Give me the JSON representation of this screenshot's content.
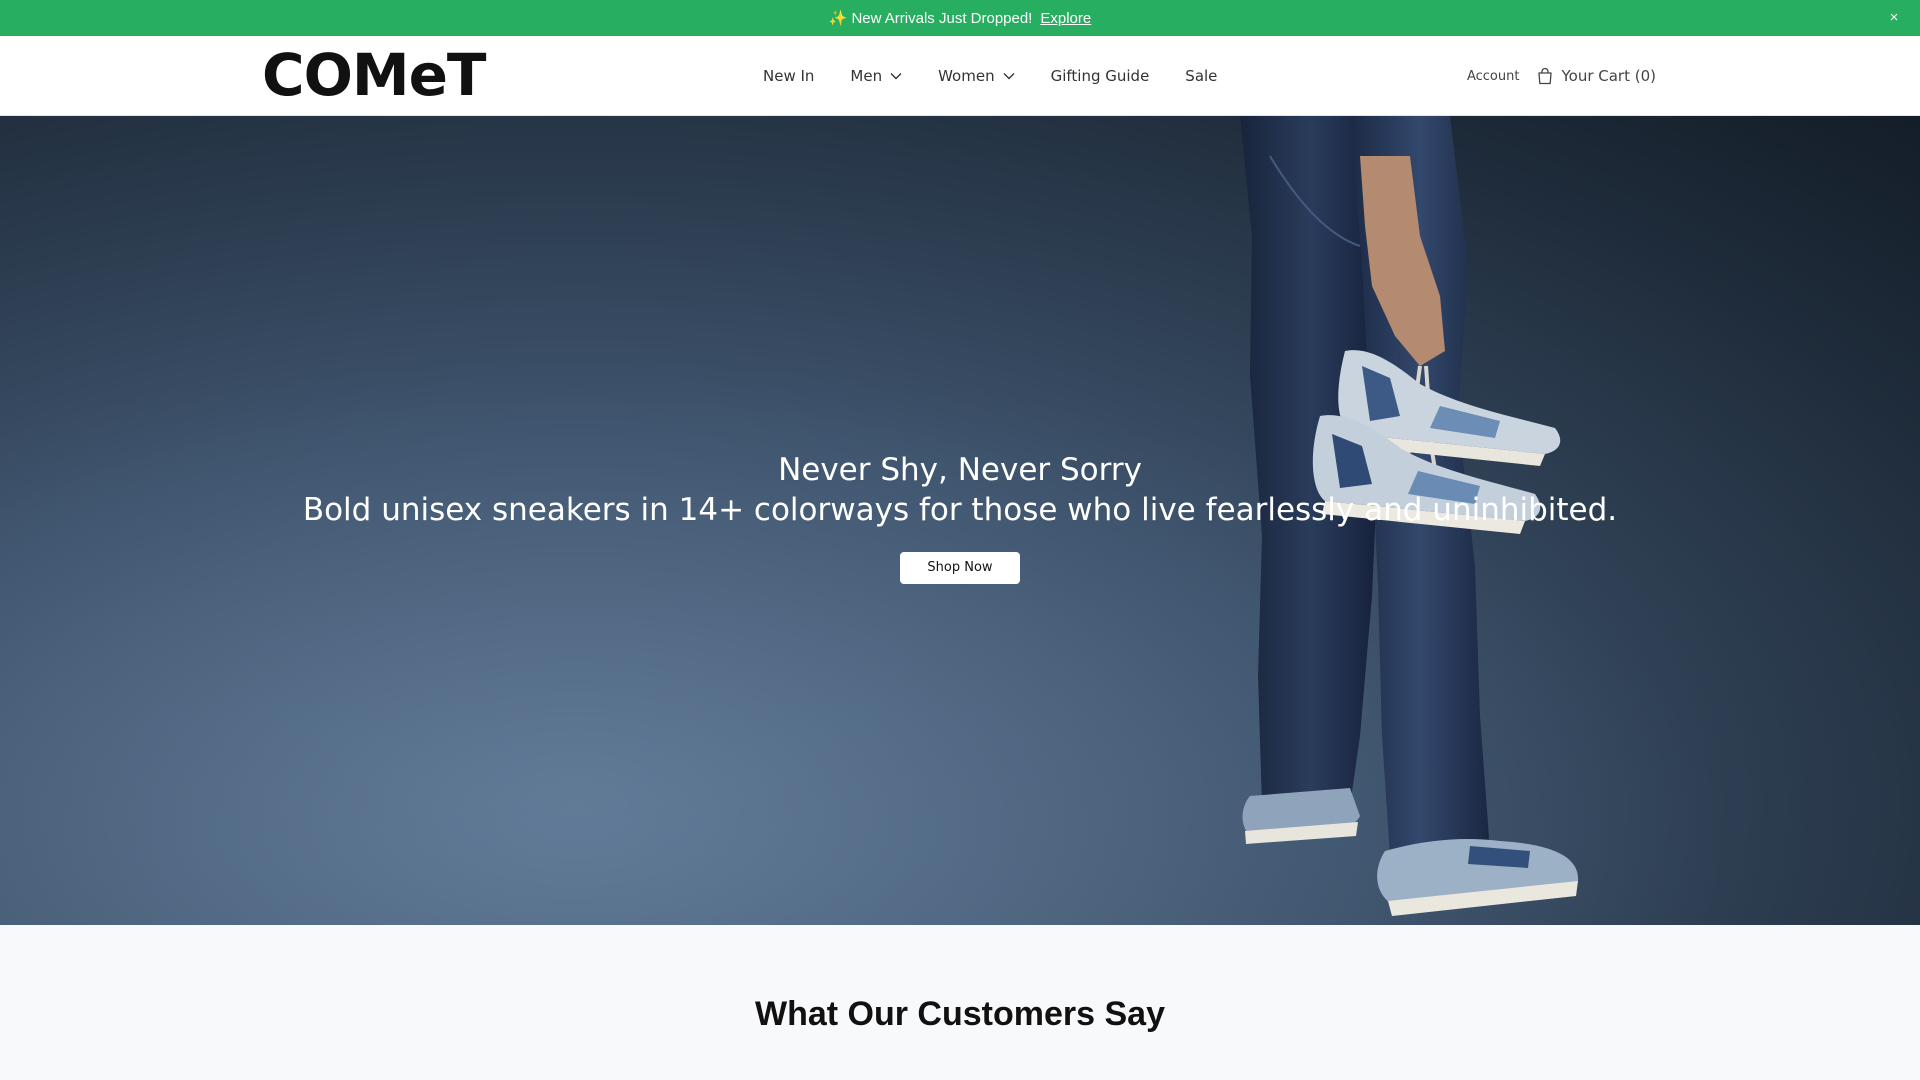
{
  "announcement": {
    "icon": "sparkle-icon",
    "message": "New Arrivals Just Dropped!",
    "link_label": "Explore",
    "close_label": "×",
    "background": "#27ae60"
  },
  "header": {
    "logo_text": "COMeT",
    "nav": [
      {
        "label": "New In"
      },
      {
        "label": "Men"
      },
      {
        "label": "Women"
      },
      {
        "label": "Gifting Guide"
      },
      {
        "label": "Sale"
      }
    ],
    "account_label": "Account",
    "cart_label": "Your Cart (0)"
  },
  "hero": {
    "title": "Never Shy, Never Sorry",
    "subtitle": "Bold unisex sneakers in 14+ colorways for those who live fearlessly and uninhibited.",
    "cta_label": "Shop Now"
  },
  "testimonials": {
    "heading": "What Our Customers Say"
  }
}
